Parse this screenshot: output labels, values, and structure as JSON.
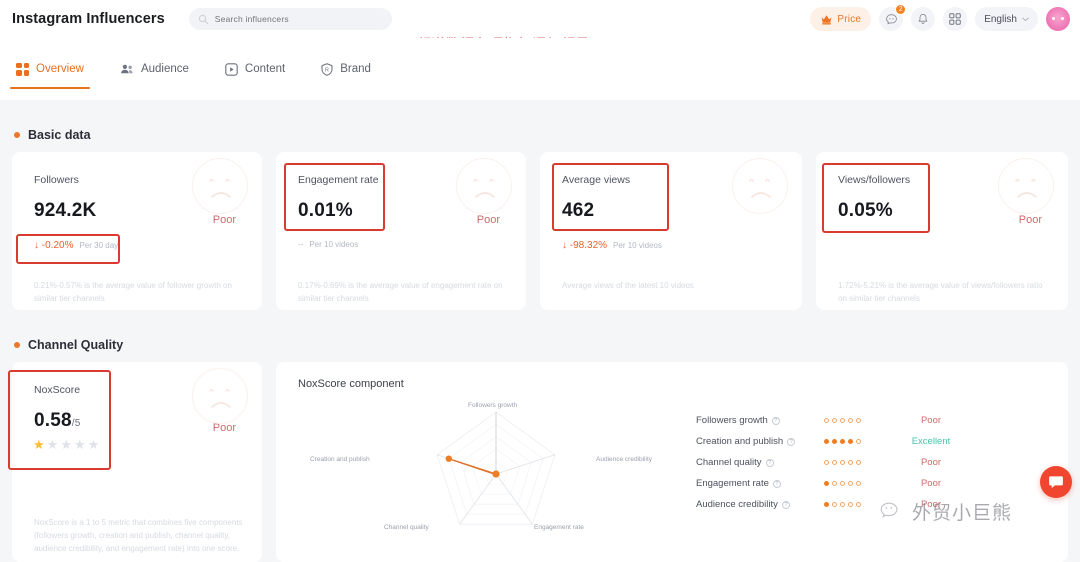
{
  "header": {
    "brand": "Instagram Influencers",
    "search": {
      "placeholder": "Search influencers",
      "value": "",
      "icon": "search-icon"
    },
    "price_label": "Price",
    "price_icon": "crown-hand-icon",
    "message_icon": "message-icon",
    "message_badge": "2",
    "bell_icon": "bell-icon",
    "apps_icon": "grid-apps-icon",
    "language": "English",
    "chevron_icon": "chevron-down-icon",
    "avatar_icon": "user-avatar"
  },
  "annotation": "频道数据各项指标评级都是Poor",
  "tabs": [
    {
      "label": "Overview",
      "icon": "grid-squares-icon",
      "active": true
    },
    {
      "label": "Audience",
      "icon": "people-icon",
      "active": false
    },
    {
      "label": "Content",
      "icon": "play-box-icon",
      "active": false
    },
    {
      "label": "Brand",
      "icon": "shield-r-icon",
      "active": false
    }
  ],
  "sections": {
    "basic_data": "Basic data",
    "channel_quality": "Channel Quality"
  },
  "basic_cards": [
    {
      "label": "Followers",
      "value": "924.2K",
      "unit": "",
      "delta": "-0.20%",
      "delta_arrow": "↓",
      "delta_period": "Per 30 day",
      "rating": "Poor",
      "note": "0.21%-0.57% is the average value of follower growth on similar tier channels",
      "face_icon": "sad-face-icon"
    },
    {
      "label": "Engagement rate",
      "value": "0.01%",
      "unit": "",
      "delta": "--",
      "delta_arrow": "",
      "delta_period": "Per 10 videos",
      "rating": "Poor",
      "note": "0.17%-0.69% is the average value of engagement rate on similar tier channels",
      "face_icon": "sad-face-icon"
    },
    {
      "label": "Average views",
      "value": "462",
      "unit": "",
      "delta": "-98.32%",
      "delta_arrow": "↓",
      "delta_period": "Per 10 videos",
      "rating": "",
      "note": "Average views of the latest 10 videos",
      "face_icon": "sad-face-icon"
    },
    {
      "label": "Views/followers",
      "value": "0.05%",
      "unit": "",
      "delta": "",
      "delta_arrow": "",
      "delta_period": "",
      "rating": "Poor",
      "note": "1.72%-5.21% is the average value of views/followers ratio on similar tier channels",
      "face_icon": "sad-face-icon"
    }
  ],
  "noxscore_card": {
    "label": "NoxScore",
    "value": "0.58",
    "unit": "/5",
    "rating": "Poor",
    "stars_filled": 1,
    "stars_total": 5,
    "note": "NoxScore is a 1 to 5 metric that combines five components (followers growth, creation and publish, channel quality, audience credibility, and engagement rate) into one score.",
    "face_icon": "sad-face-icon"
  },
  "noxscore_component": {
    "title": "NoxScore component",
    "rows": [
      {
        "name": "Followers growth",
        "dots": 0,
        "dots_total": 5,
        "rating": "Poor",
        "help_icon": "question-icon"
      },
      {
        "name": "Creation and publish",
        "dots": 4,
        "dots_total": 5,
        "rating": "Excellent",
        "help_icon": "question-icon"
      },
      {
        "name": "Channel quality",
        "dots": 0,
        "dots_total": 5,
        "rating": "Poor",
        "help_icon": "question-icon"
      },
      {
        "name": "Engagement rate",
        "dots": 1,
        "dots_total": 5,
        "rating": "Poor",
        "help_icon": "question-icon"
      },
      {
        "name": "Audience credibility",
        "dots": 1,
        "dots_total": 5,
        "rating": "Poor",
        "help_icon": "question-icon"
      }
    ]
  },
  "chart_data": {
    "type": "radar",
    "title": "NoxScore component",
    "categories": [
      "Followers growth",
      "Audience credibility",
      "Engagement rate",
      "Channel quality",
      "Creation and publish"
    ],
    "series": [
      {
        "name": "NoxScore",
        "values": [
          0,
          0.15,
          0.05,
          0.05,
          4
        ]
      }
    ],
    "rlim": [
      0,
      5
    ],
    "rings": 5,
    "grid": true,
    "legend": false,
    "accent_color": "#ef7d22"
  },
  "watermark": {
    "text": "外贸小巨熊",
    "icon": "wechat-icon"
  },
  "support": {
    "icon": "chat-support-icon"
  },
  "colors": {
    "accent": "#ea6f23",
    "poor": "#d06a6a",
    "excellent": "#3fc0a8",
    "annotation": "#e06666",
    "page_bg": "#f5f6f8"
  }
}
